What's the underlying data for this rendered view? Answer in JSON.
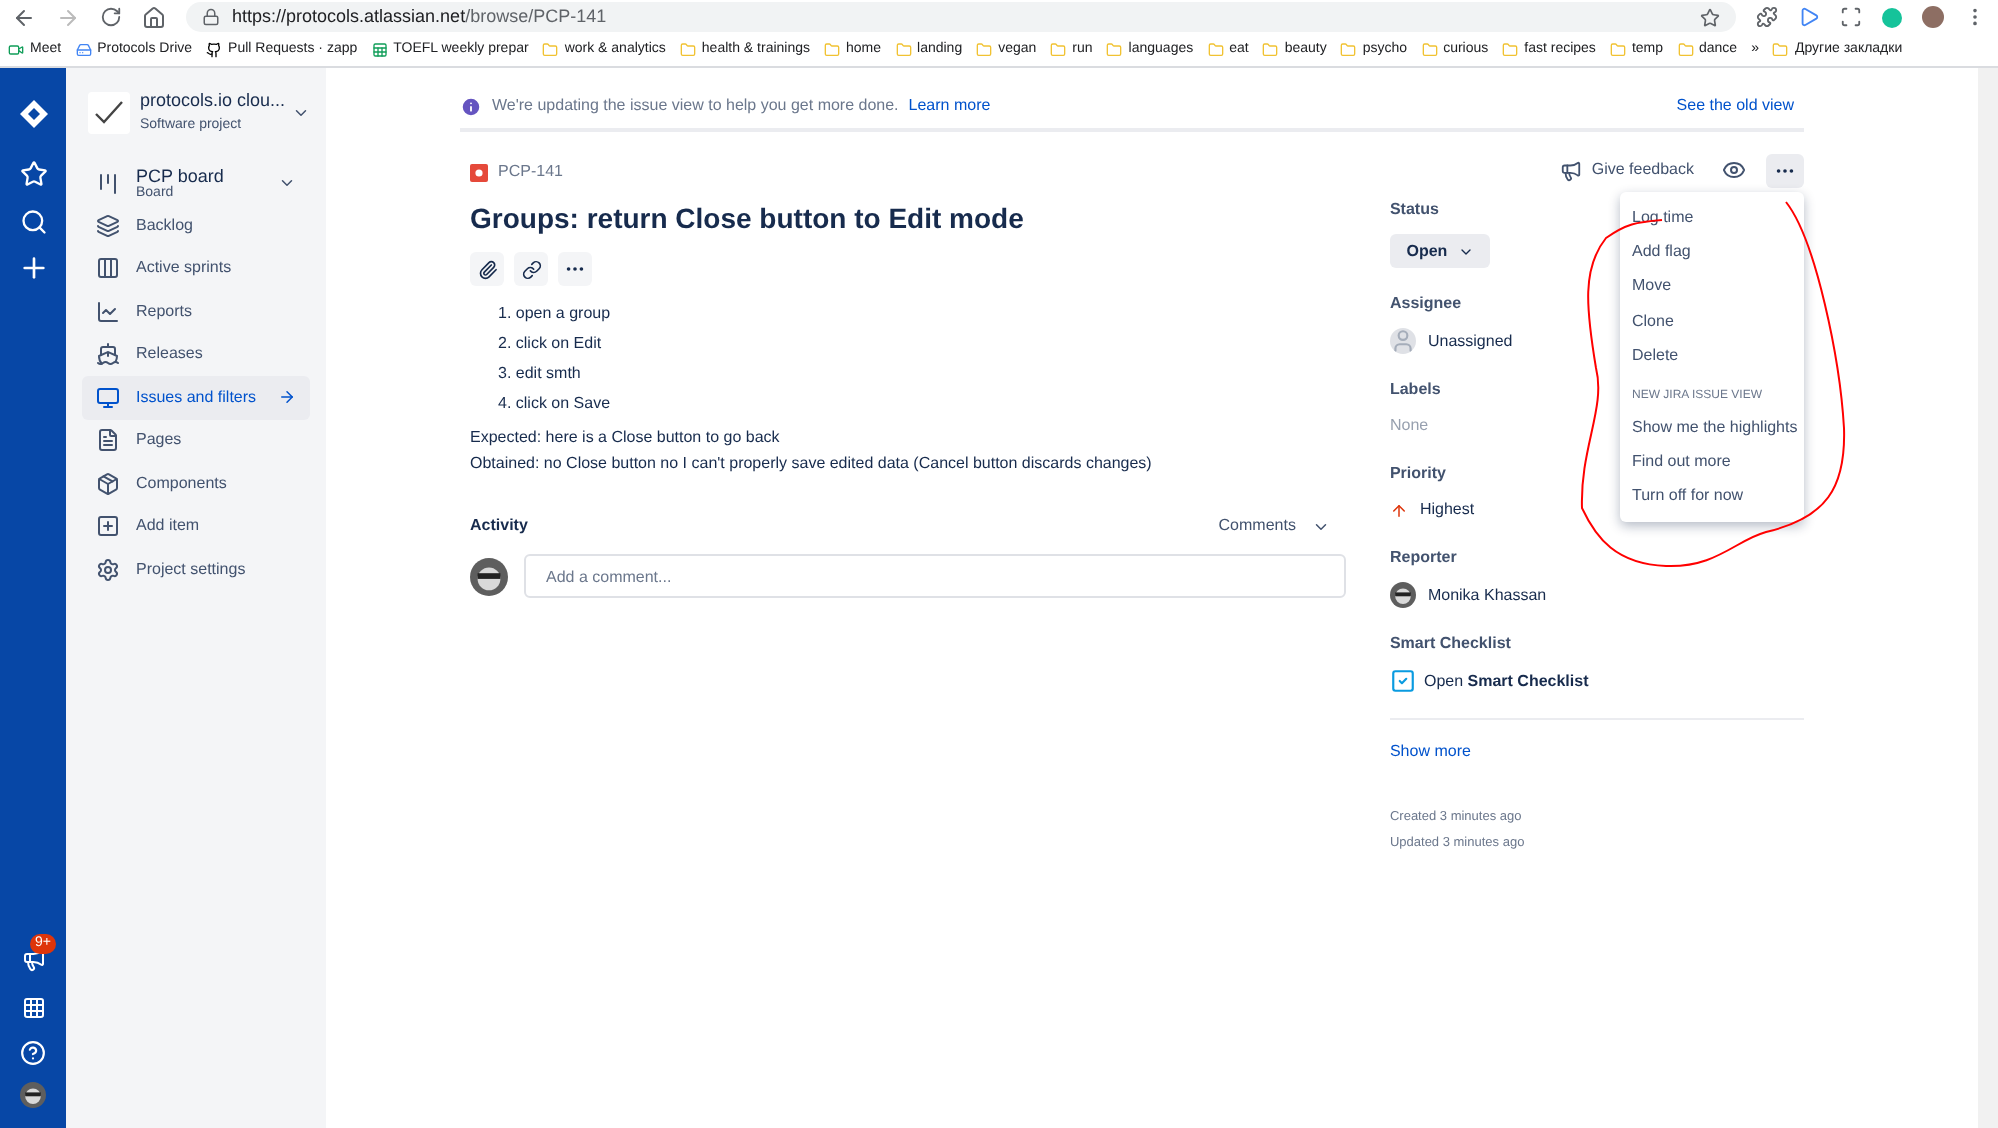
{
  "browser": {
    "url_host": "https://protocols.atlassian.net",
    "url_path": "/browse/PCP-141",
    "bookmarks": [
      {
        "label": "Meet",
        "kind": "meet"
      },
      {
        "label": "Protocols Drive",
        "kind": "drive"
      },
      {
        "label": "Pull Requests · zapp",
        "kind": "github"
      },
      {
        "label": "TOEFL weekly prepar",
        "kind": "sheet"
      },
      {
        "label": "work & analytics",
        "kind": "folder"
      },
      {
        "label": "health & trainings",
        "kind": "folder"
      },
      {
        "label": "home",
        "kind": "folder"
      },
      {
        "label": "landing",
        "kind": "folder"
      },
      {
        "label": "vegan",
        "kind": "folder"
      },
      {
        "label": "run",
        "kind": "folder"
      },
      {
        "label": "languages",
        "kind": "folder"
      },
      {
        "label": "eat",
        "kind": "folder"
      },
      {
        "label": "beauty",
        "kind": "folder"
      },
      {
        "label": "psycho",
        "kind": "folder"
      },
      {
        "label": "curious",
        "kind": "folder"
      },
      {
        "label": "fast recipes",
        "kind": "folder"
      },
      {
        "label": "temp",
        "kind": "folder"
      },
      {
        "label": "dance",
        "kind": "folder"
      }
    ],
    "overflow": "»",
    "other_bookmarks": "Другие закладки"
  },
  "rail": {
    "badge": "9+"
  },
  "sidebar": {
    "project": {
      "name": "protocols.io clou...",
      "type": "Software project"
    },
    "board": {
      "name": "PCP board",
      "type": "Board"
    },
    "items": [
      {
        "label": "Backlog",
        "selected": false
      },
      {
        "label": "Active sprints",
        "selected": false
      },
      {
        "label": "Reports",
        "selected": false
      },
      {
        "label": "Releases",
        "selected": false
      },
      {
        "label": "Issues and filters",
        "selected": true
      },
      {
        "label": "Pages",
        "selected": false
      },
      {
        "label": "Components",
        "selected": false
      },
      {
        "label": "Add item",
        "selected": false
      },
      {
        "label": "Project settings",
        "selected": false
      }
    ]
  },
  "banner": {
    "text": "We're updating the issue view to help you get more done.",
    "link": "Learn more",
    "old_view": "See the old view"
  },
  "issue": {
    "key": "PCP-141",
    "title": "Groups: return Close button to Edit mode",
    "steps": [
      {
        "number": "1.",
        "text": "open a group"
      },
      {
        "number": "2.",
        "text": "click on Edit"
      },
      {
        "number": "3.",
        "text": "edit smth"
      },
      {
        "number": "4.",
        "text": "click on Save"
      }
    ],
    "paragraphs": [
      "Expected: here is a Close button to go back",
      "Obtained: no Close button no I can't properly save edited data (Cancel button discards changes)"
    ],
    "activity": "Activity",
    "comments_filter": "Comments",
    "comment_placeholder": "Add a comment..."
  },
  "details": {
    "feedback": "Give feedback",
    "more_open": true,
    "status": {
      "label": "Status",
      "value": "Open"
    },
    "assignee": {
      "label": "Assignee",
      "value": "Unassigned"
    },
    "labels": {
      "label": "Labels",
      "value": "None"
    },
    "priority": {
      "label": "Priority",
      "value": "Highest"
    },
    "reporter": {
      "label": "Reporter",
      "value": "Monika Khassan"
    },
    "checklist": {
      "label": "Smart Checklist",
      "value": "Open **Smart Checklist**"
    },
    "show_more": "Show more",
    "created": "Created 3 minutes ago",
    "updated": "Updated 3 minutes ago"
  },
  "menu": [
    {
      "kind": "item",
      "label": "Log time"
    },
    {
      "kind": "item",
      "label": "Add flag"
    },
    {
      "kind": "item",
      "label": "Move"
    },
    {
      "kind": "item",
      "label": "Clone"
    },
    {
      "kind": "item",
      "label": "Delete"
    },
    {
      "kind": "header",
      "label": "NEW JIRA ISSUE VIEW"
    },
    {
      "kind": "item",
      "label": "Show me the highlights"
    },
    {
      "kind": "item",
      "label": "Find out more"
    },
    {
      "kind": "item",
      "label": "Turn off for now"
    }
  ]
}
